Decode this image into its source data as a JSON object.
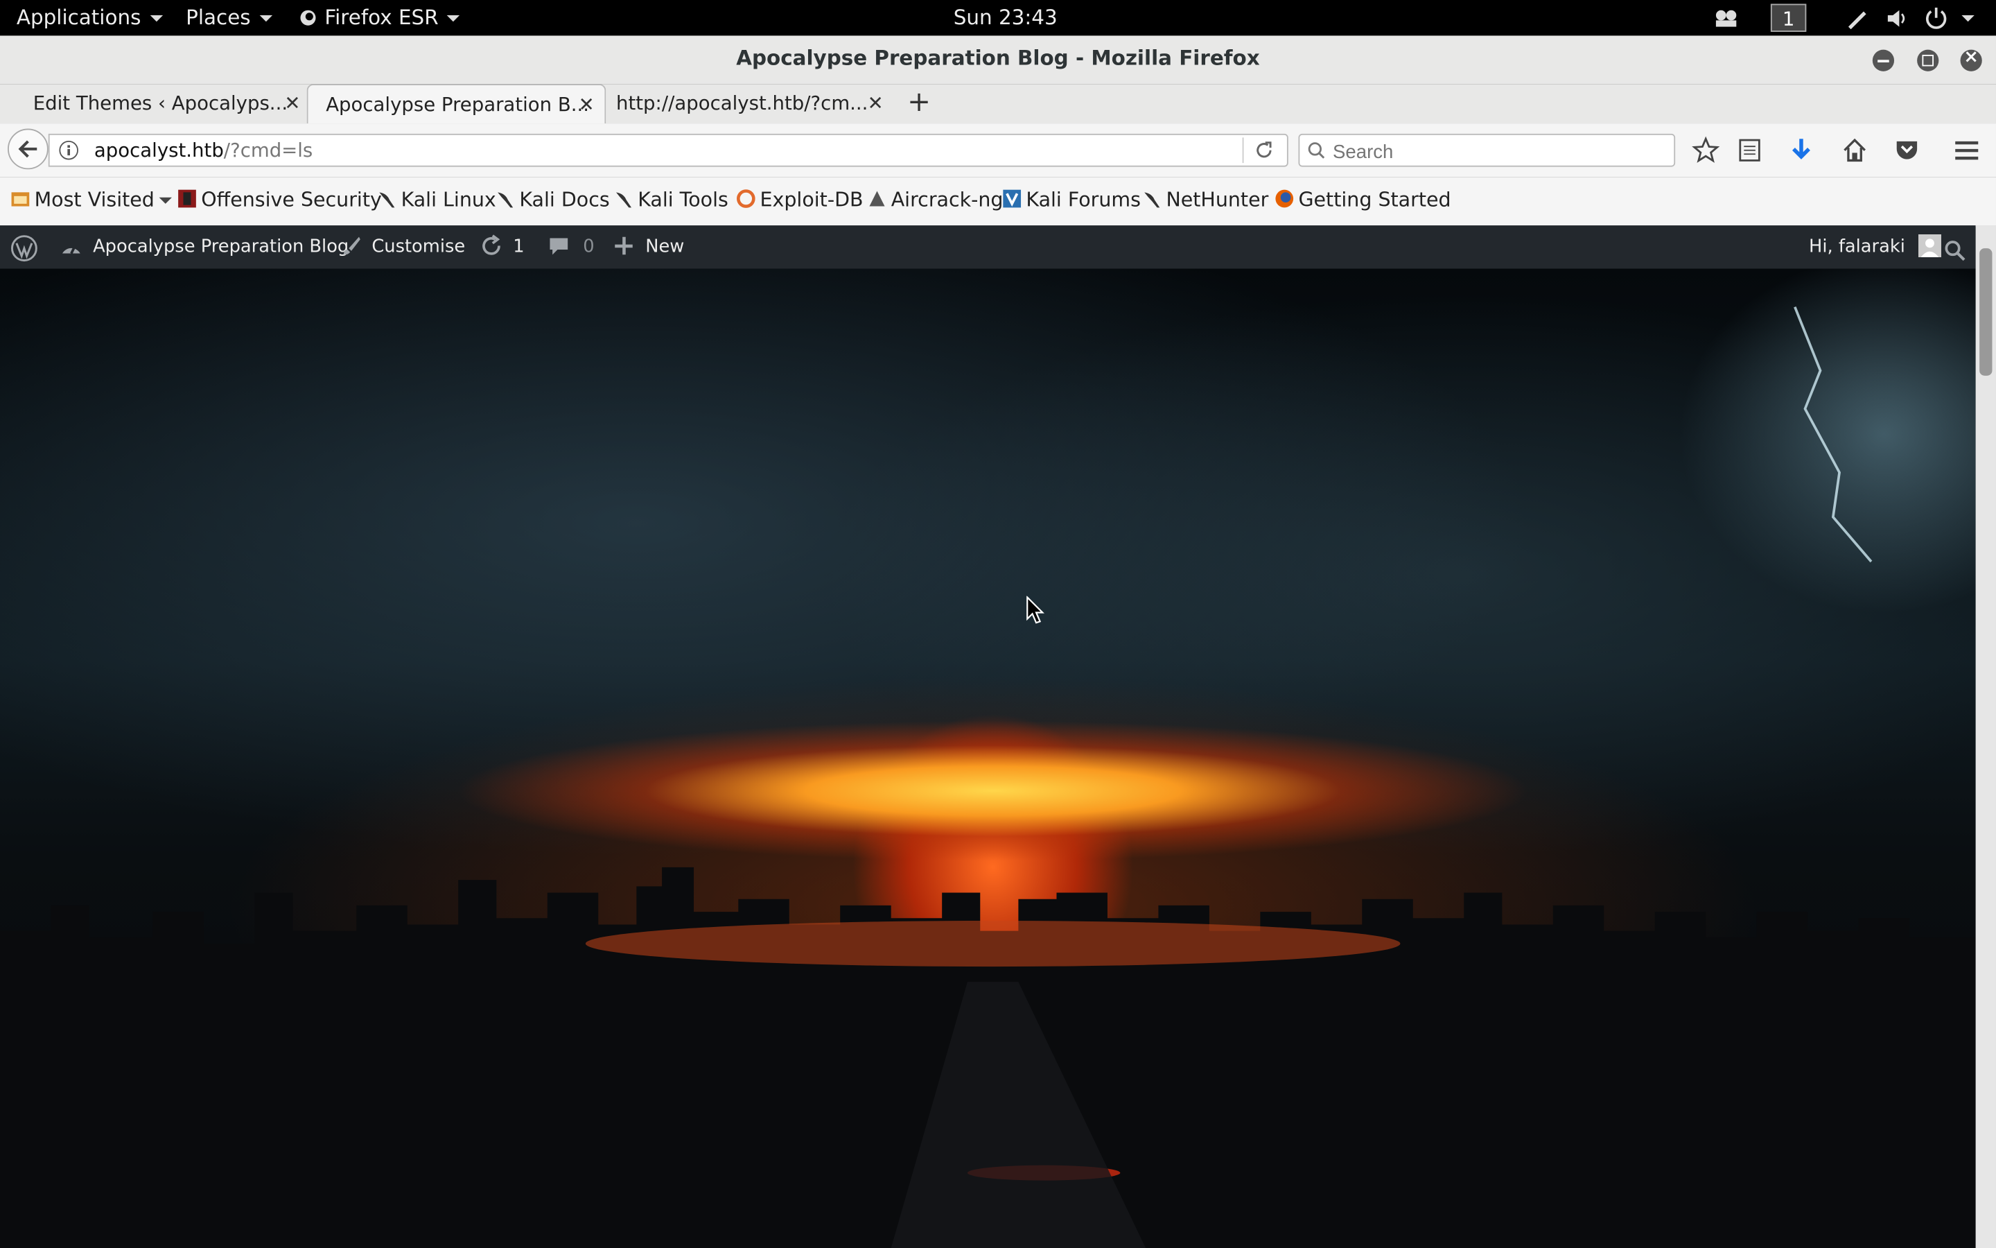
{
  "gnome_bar": {
    "applications": "Applications",
    "places": "Places",
    "firefox": "Firefox ESR",
    "clock": "Sun 23:43",
    "workspace": "1"
  },
  "window": {
    "title": "Apocalypse Preparation Blog - Mozilla Firefox"
  },
  "tabs": [
    {
      "label": "Edit Themes ‹ Apocalyps...",
      "active": false
    },
    {
      "label": "Apocalypse Preparation B...",
      "active": true
    },
    {
      "label": "http://apocalyst.htb/?cm...",
      "active": false
    }
  ],
  "navbar": {
    "url_host": "apocalyst.htb",
    "url_path": "/?cmd=ls",
    "search_placeholder": "Search"
  },
  "bookmarks": [
    {
      "label": "Most Visited",
      "icon": "most-visited-icon"
    },
    {
      "label": "Offensive Security",
      "icon": "offsec-icon"
    },
    {
      "label": "Kali Linux",
      "icon": "kali-dragon-icon"
    },
    {
      "label": "Kali Docs",
      "icon": "kali-dragon-icon"
    },
    {
      "label": "Kali Tools",
      "icon": "kali-dragon-icon"
    },
    {
      "label": "Exploit-DB",
      "icon": "exploit-db-icon"
    },
    {
      "label": "Aircrack-ng",
      "icon": "aircrack-icon"
    },
    {
      "label": "Kali Forums",
      "icon": "kali-forums-icon"
    },
    {
      "label": "NetHunter",
      "icon": "kali-dragon-icon"
    },
    {
      "label": "Getting Started",
      "icon": "firefox-icon"
    }
  ],
  "wp_admin_bar": {
    "site_name": "Apocalypse Preparation Blog",
    "customise": "Customise",
    "updates_count": "1",
    "comments_count": "0",
    "new_label": "New",
    "greeting": "Hi, falaraki"
  },
  "colors": {
    "wp_bar": "#23282d",
    "download_arrow": "#1a73e8"
  }
}
